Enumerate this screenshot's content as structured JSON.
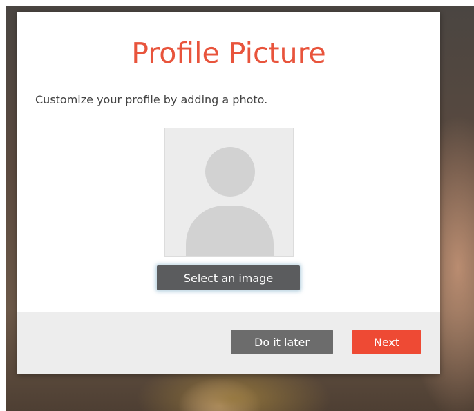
{
  "dialog": {
    "title": "Profile Picture",
    "subtitle": "Customize your profile by adding a photo.",
    "select_image_label": "Select an image",
    "do_it_later_label": "Do it later",
    "next_label": "Next"
  },
  "colors": {
    "title_accent": "#e8543c",
    "next_button": "#ee4a34",
    "select_button": "#5b5c5e",
    "later_button": "#6c6c6c",
    "placeholder_fill": "#d2d2d2"
  },
  "icons": {
    "avatar": "avatar-placeholder-icon"
  }
}
